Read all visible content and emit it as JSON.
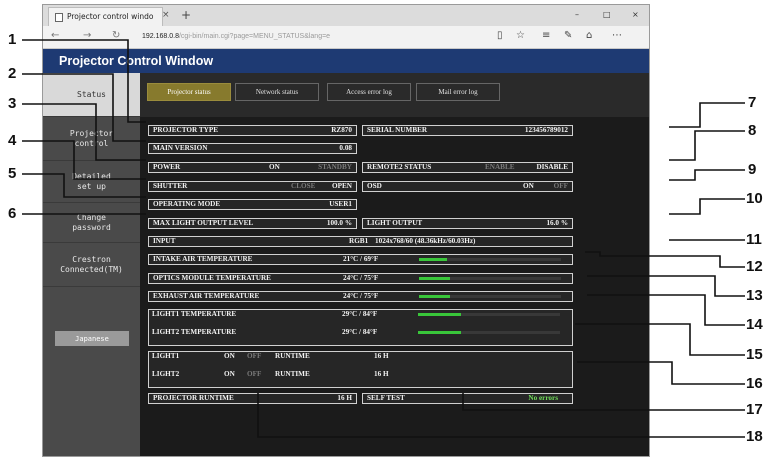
{
  "browser": {
    "tab_title": "Projector control windo",
    "tab_close": "×",
    "new_tab": "+",
    "window_controls": [
      "–",
      "□",
      "×"
    ],
    "url_host": "192.168.0.8",
    "url_path": "/cgi-bin/main.cgi?page=MENU_STATUS&lang=e",
    "icons": [
      "reading-view-icon",
      "favorite-star-icon",
      "hub-icon",
      "web-note-icon",
      "share-icon",
      "more-icon"
    ]
  },
  "page": {
    "title": "Projector Control Window",
    "sidebar": [
      {
        "label": "Status",
        "active": true
      },
      {
        "label": "Projector\ncontrol",
        "active": false
      },
      {
        "label": "Detailed\nset up",
        "active": false
      },
      {
        "label": "Change\npassword",
        "active": false
      },
      {
        "label": "Crestron\nConnected(TM)",
        "active": false
      }
    ],
    "language_button": "Japanese",
    "subtabs": [
      "Projector status",
      "Network status",
      "Access error log",
      "Mail error log"
    ],
    "status": {
      "projector_type": {
        "label": "PROJECTOR TYPE",
        "value": "RZ870"
      },
      "main_version": {
        "label": "MAIN VERSION",
        "value": "0.08"
      },
      "power": {
        "label": "POWER",
        "on": "ON",
        "standby": "STANDBY"
      },
      "shutter": {
        "label": "SHUTTER",
        "close": "CLOSE",
        "open": "OPEN"
      },
      "operating_mode": {
        "label": "OPERATING MODE",
        "value": "USER1"
      },
      "max_light": {
        "label": "MAX LIGHT OUTPUT LEVEL",
        "value": "100.0 %"
      },
      "serial": {
        "label": "SERIAL NUMBER",
        "value": "123456789012"
      },
      "remote2": {
        "label": "REMOTE2 STATUS",
        "enable": "ENABLE",
        "disable": "DISABLE"
      },
      "osd": {
        "label": "OSD",
        "on": "ON",
        "off": "OFF"
      },
      "light_output": {
        "label": "LIGHT OUTPUT",
        "value": "16.0 %"
      },
      "input": {
        "label": "INPUT",
        "value": "RGB1",
        "signal": "1024x768/60 (48.36kHz/60.03Hz)"
      },
      "temperatures": [
        {
          "label": "INTAKE AIR TEMPERATURE",
          "value": "21°C / 69°F",
          "level": 0.2
        },
        {
          "label": "OPTICS MODULE TEMPERATURE",
          "value": "24°C / 75°F",
          "level": 0.22
        },
        {
          "label": "EXHAUST AIR TEMPERATURE",
          "value": "24°C / 75°F",
          "level": 0.22
        },
        {
          "label": "LIGHT1 TEMPERATURE",
          "value": "29°C / 84°F",
          "level": 0.3
        },
        {
          "label": "LIGHT2 TEMPERATURE",
          "value": "29°C / 84°F",
          "level": 0.3
        }
      ],
      "lights": [
        {
          "label": "LIGHT1",
          "on": "ON",
          "off": "OFF",
          "runtime_label": "RUNTIME",
          "runtime": "16 H"
        },
        {
          "label": "LIGHT2",
          "on": "ON",
          "off": "OFF",
          "runtime_label": "RUNTIME",
          "runtime": "16 H"
        }
      ],
      "projector_runtime": {
        "label": "PROJECTOR RUNTIME",
        "value": "16 H"
      },
      "self_test": {
        "label": "SELF TEST",
        "value": "No errors"
      }
    }
  },
  "callouts": [
    "1",
    "2",
    "3",
    "4",
    "5",
    "6",
    "7",
    "8",
    "9",
    "10",
    "11",
    "12",
    "13",
    "14",
    "15",
    "16",
    "17",
    "18"
  ]
}
